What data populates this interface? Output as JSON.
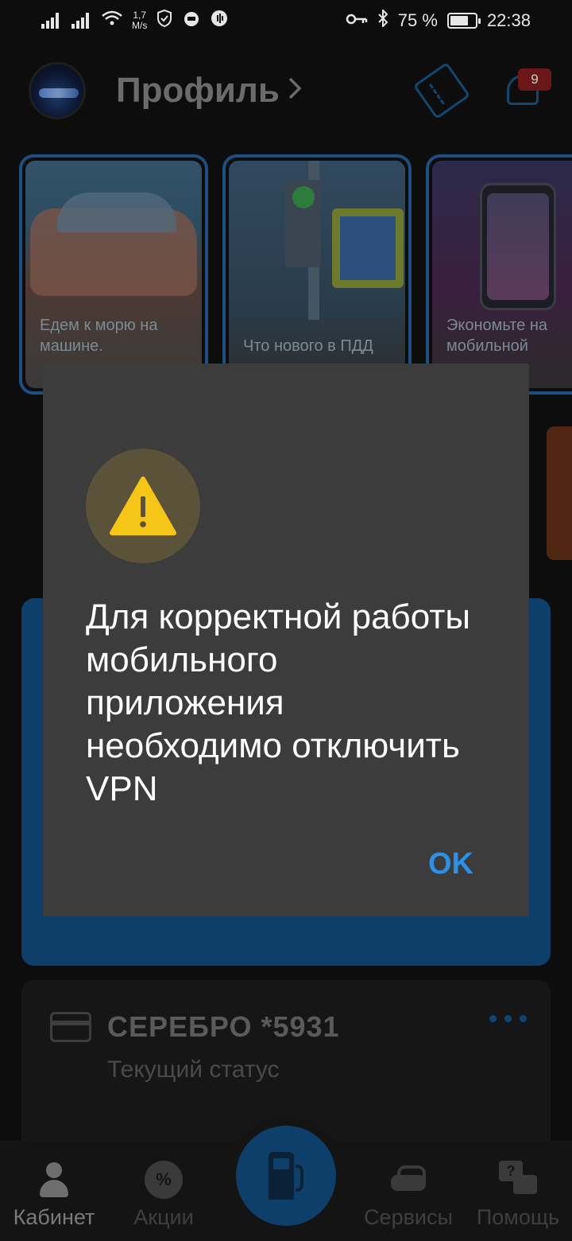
{
  "status_bar": {
    "speed_value": "1,7",
    "speed_unit": "M/s",
    "battery": "75 %",
    "battery_level": 0.75,
    "time": "22:38"
  },
  "header": {
    "title": "Профиль",
    "notifications_count": "9",
    "icons": [
      "avatar",
      "ticket-icon",
      "bell-icon"
    ]
  },
  "stories": [
    {
      "text": "Едем к морю на машине."
    },
    {
      "text": "Что нового в ПДД"
    },
    {
      "text": "Экономьте на мобильной"
    }
  ],
  "loyalty_card": {
    "title": "СЕРЕБРО *5931",
    "subtitle": "Текущий статус"
  },
  "bottom_nav": {
    "items": [
      {
        "label": "Кабинет",
        "icon": "person-icon",
        "active": true
      },
      {
        "label": "Акции",
        "icon": "percent-gear-icon"
      },
      {
        "label": "",
        "icon": "fuel-pump-icon"
      },
      {
        "label": "Сервисы",
        "icon": "car-icon"
      },
      {
        "label": "Помощь",
        "icon": "chat-help-icon"
      }
    ]
  },
  "dialog": {
    "icon": "warning-icon",
    "message": "Для корректной работы мобильного приложения необходимо отключить VPN",
    "ok_label": "OK"
  },
  "colors": {
    "accent": "#2d8fe6",
    "dialog_bg": "#3c3c3c",
    "warning": "#f5c518"
  }
}
